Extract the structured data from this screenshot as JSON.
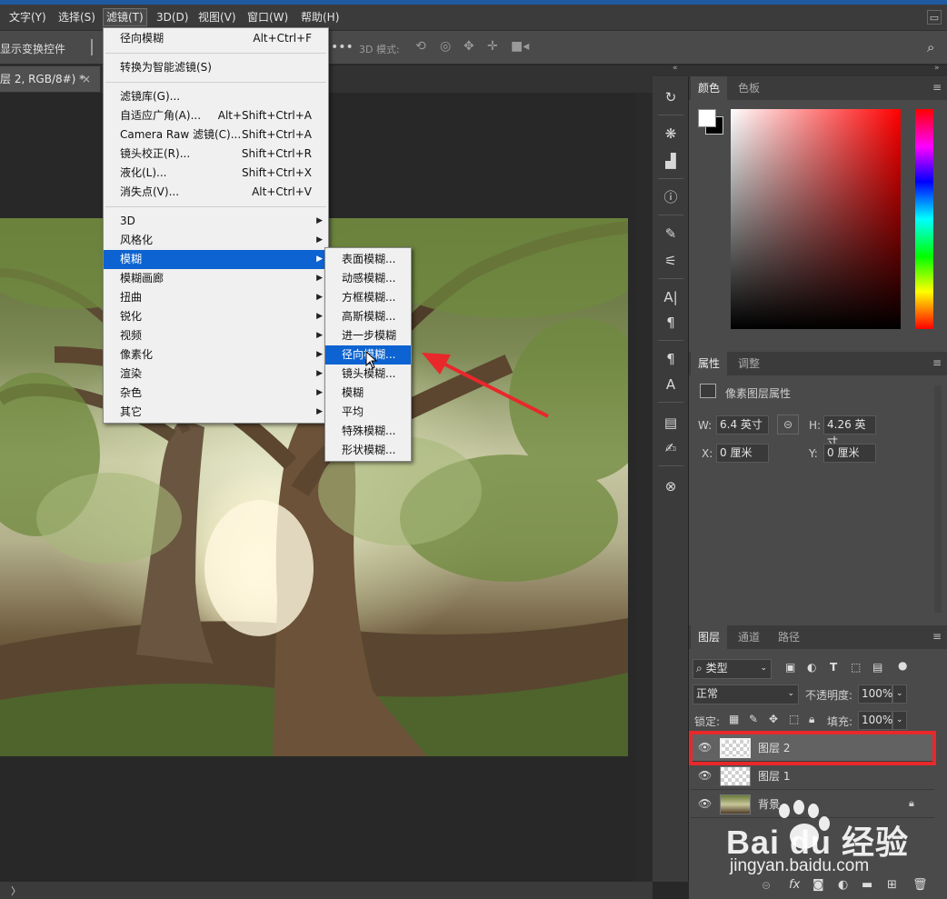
{
  "menubar": {
    "items": [
      "文字(Y)",
      "选择(S)",
      "滤镜(T)",
      "3D(D)",
      "视图(V)",
      "窗口(W)",
      "帮助(H)"
    ]
  },
  "options_bar": {
    "show_transform": "显示变换控件",
    "mode_3d": "3D 模式:"
  },
  "document_tab": {
    "title": "层 2, RGB/8#) *",
    "close": "×"
  },
  "filter_menu": {
    "last_filter": {
      "label": "径向模糊",
      "shortcut": "Alt+Ctrl+F"
    },
    "smart": {
      "label": "转换为智能滤镜(S)"
    },
    "group2": [
      {
        "label": "滤镜库(G)...",
        "shortcut": ""
      },
      {
        "label": "自适应广角(A)...",
        "shortcut": "Alt+Shift+Ctrl+A"
      },
      {
        "label": "Camera Raw 滤镜(C)...",
        "shortcut": "Shift+Ctrl+A"
      },
      {
        "label": "镜头校正(R)...",
        "shortcut": "Shift+Ctrl+R"
      },
      {
        "label": "液化(L)...",
        "shortcut": "Shift+Ctrl+X"
      },
      {
        "label": "消失点(V)...",
        "shortcut": "Alt+Ctrl+V"
      }
    ],
    "submenus": [
      "3D",
      "风格化",
      "模糊",
      "模糊画廊",
      "扭曲",
      "锐化",
      "视频",
      "像素化",
      "渲染",
      "杂色",
      "其它"
    ],
    "highlighted": "模糊"
  },
  "blur_submenu": {
    "items": [
      "表面模糊...",
      "动感模糊...",
      "方框模糊...",
      "高斯模糊...",
      "进一步模糊",
      "径向模糊...",
      "镜头模糊...",
      "模糊",
      "平均",
      "特殊模糊...",
      "形状模糊..."
    ],
    "highlighted": "径向模糊..."
  },
  "color_panel": {
    "tabs": [
      "颜色",
      "色板"
    ],
    "foreground": "#ffffff",
    "background": "#000000"
  },
  "properties_panel": {
    "tabs": [
      "属性",
      "调整"
    ],
    "heading": "像素图层属性",
    "w_label": "W:",
    "w_value": "6.4 英寸",
    "h_label": "H:",
    "h_value": "4.26 英寸",
    "x_label": "X:",
    "x_value": "0 厘米",
    "y_label": "Y:",
    "y_value": "0 厘米"
  },
  "layers_panel": {
    "tabs": [
      "图层",
      "通道",
      "路径"
    ],
    "filter_kind": "类型",
    "blend_mode": "正常",
    "opacity_label": "不透明度:",
    "opacity": "100%",
    "lock_label": "锁定:",
    "fill_label": "填充:",
    "fill": "100%",
    "layers": [
      {
        "name": "图层 2",
        "selected": true
      },
      {
        "name": "图层 1",
        "selected": false
      },
      {
        "name": "背景",
        "locked": true
      }
    ]
  },
  "watermark": {
    "brand": "Bai du 经验",
    "url": "jingyan.baidu.com"
  },
  "colors": {
    "highlight": "#0c63d1",
    "annotation_red": "#e8282b"
  }
}
